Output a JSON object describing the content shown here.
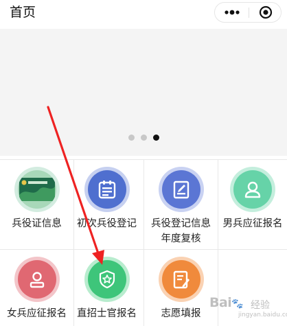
{
  "navbar": {
    "title": "首页",
    "more_icon": "more-dots-icon",
    "close_icon": "miniprogram-close-icon"
  },
  "banner": {
    "carousel_pages": 3,
    "active_page": 3
  },
  "grid": {
    "items": [
      {
        "label": "兵役证信息",
        "icon": "id-card-icon",
        "color": "#a8d8b9"
      },
      {
        "label": "初次兵役登记",
        "icon": "clipboard-list-icon",
        "color": "#4f6fcf"
      },
      {
        "label": "兵役登记信息年度复核",
        "icon": "edit-document-icon",
        "color": "#5b76d4"
      },
      {
        "label": "男兵应征报名",
        "icon": "user-icon",
        "color": "#66d3a8"
      },
      {
        "label": "女兵应征报名",
        "icon": "user-icon",
        "color": "#e06872"
      },
      {
        "label": "直招士官报名",
        "icon": "star-shield-icon",
        "color": "#3ec57a"
      },
      {
        "label": "志愿填报",
        "icon": "form-edit-icon",
        "color": "#f08a3c"
      }
    ]
  },
  "watermark": {
    "brand": "Bai 经验",
    "jingyan": "经验",
    "url": "jingyan.baidu.com"
  }
}
